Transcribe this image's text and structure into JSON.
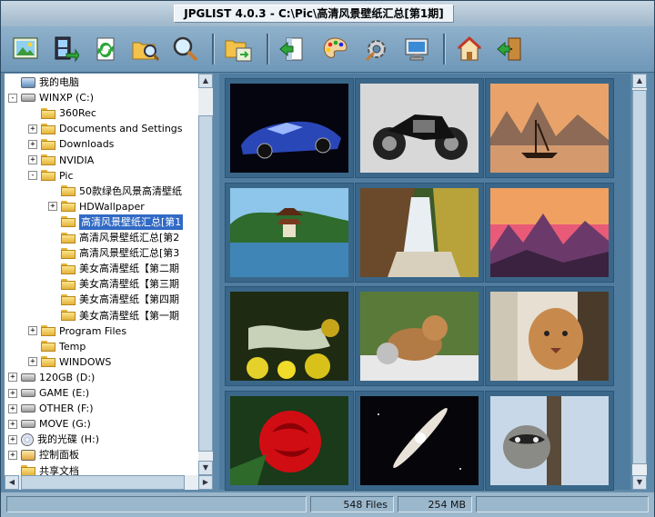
{
  "window": {
    "title": "JPGLIST 4.0.3  -  C:\\Pic\\高清风景壁纸汇总[第1期]"
  },
  "toolbar": {
    "buttons": [
      "picture-icon",
      "film-export-icon",
      "refresh-icon",
      "folder-search-icon",
      "magnifier-icon",
      "folder-move-icon",
      "panel-back-icon",
      "palette-icon",
      "gear-icon",
      "monitor-icon",
      "home-icon",
      "exit-door-icon"
    ]
  },
  "tree": {
    "items": [
      {
        "label": "我的电脑"
      },
      {
        "label": "WINXP (C:)",
        "exp": "-"
      },
      {
        "label": "360Rec"
      },
      {
        "label": "Documents and Settings",
        "exp": "+"
      },
      {
        "label": "Downloads",
        "exp": "+"
      },
      {
        "label": "NVIDIA",
        "exp": "+"
      },
      {
        "label": "Pic",
        "exp": "-"
      },
      {
        "label": "50款绿色风景高清壁纸"
      },
      {
        "label": "HDWallpaper",
        "exp": "+"
      },
      {
        "label": "高清风景壁纸汇总[第1"
      },
      {
        "label": "高清风景壁纸汇总[第2"
      },
      {
        "label": "高清风景壁纸汇总[第3"
      },
      {
        "label": "美女高清壁纸【第二期"
      },
      {
        "label": "美女高清壁纸【第三期"
      },
      {
        "label": "美女高清壁纸【第四期"
      },
      {
        "label": "美女高清壁纸【第一期"
      },
      {
        "label": "Program Files",
        "exp": "+"
      },
      {
        "label": "Temp"
      },
      {
        "label": "WINDOWS",
        "exp": "+"
      },
      {
        "label": "120GB (D:)",
        "exp": "+"
      },
      {
        "label": "GAME (E:)",
        "exp": "+"
      },
      {
        "label": "OTHER (F:)",
        "exp": "+"
      },
      {
        "label": "MOVE (G:)",
        "exp": "+"
      },
      {
        "label": "我的光碟 (H:)",
        "exp": "+"
      },
      {
        "label": "控制面板",
        "exp": "+"
      },
      {
        "label": "共享文档"
      }
    ]
  },
  "thumbnails": [
    "blue-sports-car",
    "black-motorcycle",
    "junk-boat-mountains",
    "pagoda-lake",
    "waterfall-autumn",
    "sunset-mountains",
    "stream-yellow-flowers",
    "bear-cubs",
    "cougar-tree",
    "red-rose",
    "galaxy",
    "raccoon-tree"
  ],
  "status": {
    "file_count": "548 Files",
    "size": "254 MB"
  }
}
